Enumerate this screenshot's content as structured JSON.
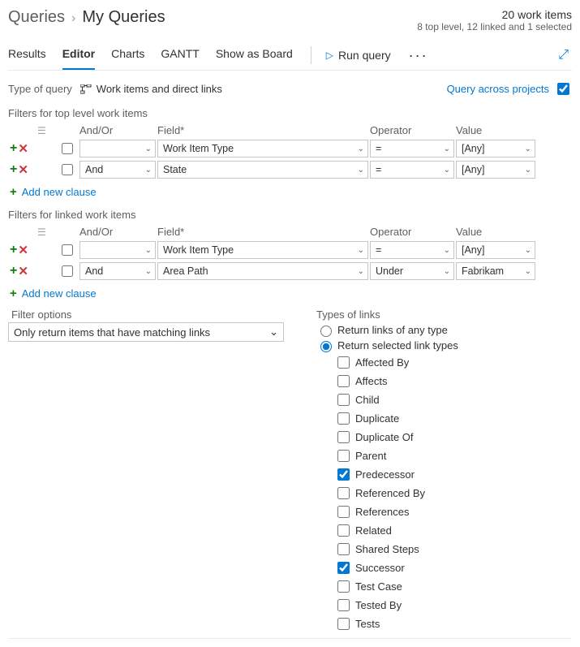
{
  "header": {
    "breadcrumb_parent": "Queries",
    "breadcrumb_current": "My Queries",
    "count_line": "20 work items",
    "detail_line": "8 top level, 12 linked and 1 selected"
  },
  "tabs": {
    "results": "Results",
    "editor": "Editor",
    "charts": "Charts",
    "gantt": "GANTT",
    "board": "Show as Board"
  },
  "toolbar": {
    "run_label": "Run query"
  },
  "type_row": {
    "label": "Type of query",
    "value": "Work items and direct links",
    "cross_label": "Query across projects"
  },
  "top_section": {
    "title": "Filters for top level work items",
    "headers": {
      "andor": "And/Or",
      "field": "Field*",
      "operator": "Operator",
      "value": "Value"
    },
    "rows": [
      {
        "andor": "",
        "field": "Work Item Type",
        "operator": "=",
        "value": "[Any]"
      },
      {
        "andor": "And",
        "field": "State",
        "operator": "=",
        "value": "[Any]"
      }
    ],
    "add_label": "Add new clause"
  },
  "linked_section": {
    "title": "Filters for linked work items",
    "headers": {
      "andor": "And/Or",
      "field": "Field*",
      "operator": "Operator",
      "value": "Value"
    },
    "rows": [
      {
        "andor": "",
        "field": "Work Item Type",
        "operator": "=",
        "value": "[Any]"
      },
      {
        "andor": "And",
        "field": "Area Path",
        "operator": "Under",
        "value": "Fabrikam"
      }
    ],
    "add_label": "Add new clause"
  },
  "filter_options": {
    "label": "Filter options",
    "selected": "Only return items that have matching links"
  },
  "link_types": {
    "title": "Types of links",
    "radio_any": "Return links of any type",
    "radio_selected": "Return selected link types",
    "items": [
      {
        "label": "Affected By",
        "checked": false
      },
      {
        "label": "Affects",
        "checked": false
      },
      {
        "label": "Child",
        "checked": false
      },
      {
        "label": "Duplicate",
        "checked": false
      },
      {
        "label": "Duplicate Of",
        "checked": false
      },
      {
        "label": "Parent",
        "checked": false
      },
      {
        "label": "Predecessor",
        "checked": true
      },
      {
        "label": "Referenced By",
        "checked": false
      },
      {
        "label": "References",
        "checked": false
      },
      {
        "label": "Related",
        "checked": false
      },
      {
        "label": "Shared Steps",
        "checked": false
      },
      {
        "label": "Successor",
        "checked": true
      },
      {
        "label": "Test Case",
        "checked": false
      },
      {
        "label": "Tested By",
        "checked": false
      },
      {
        "label": "Tests",
        "checked": false
      }
    ]
  }
}
